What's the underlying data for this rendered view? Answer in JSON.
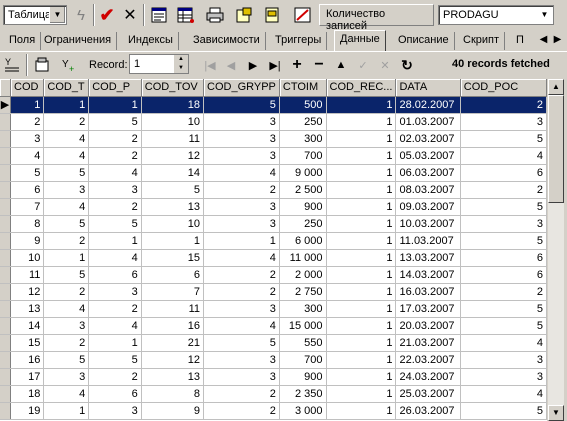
{
  "toolbar": {
    "table_select": "Таблица",
    "records_count_label": "Количество записей",
    "table_name_value": "PRODAGU"
  },
  "tabs": [
    {
      "label": "Поля"
    },
    {
      "label": "Ограничения"
    },
    {
      "label": "Индексы"
    },
    {
      "label": "Зависимости"
    },
    {
      "label": "Триггеры"
    },
    {
      "label": "Данные"
    },
    {
      "label": "Описание"
    },
    {
      "label": "Скрипт"
    },
    {
      "label": "П"
    }
  ],
  "navigator": {
    "record_label": "Record:",
    "record_value": "1",
    "fetched_text": "40 records fetched"
  },
  "grid": {
    "columns": [
      "COD",
      "COD_T",
      "COD_P",
      "COD_TOV",
      "COD_GRYPP",
      "CTOIM",
      "COD_REC...",
      "DATA",
      "COD_POC"
    ],
    "rows": [
      [
        "1",
        "1",
        "1",
        "18",
        "5",
        "500",
        "1",
        "28.02.2007",
        "2"
      ],
      [
        "2",
        "2",
        "5",
        "10",
        "3",
        "250",
        "1",
        "01.03.2007",
        "3"
      ],
      [
        "3",
        "4",
        "2",
        "11",
        "3",
        "300",
        "1",
        "02.03.2007",
        "5"
      ],
      [
        "4",
        "4",
        "2",
        "12",
        "3",
        "700",
        "1",
        "05.03.2007",
        "4"
      ],
      [
        "5",
        "5",
        "4",
        "14",
        "4",
        "9 000",
        "1",
        "06.03.2007",
        "6"
      ],
      [
        "6",
        "3",
        "3",
        "5",
        "2",
        "2 500",
        "1",
        "08.03.2007",
        "2"
      ],
      [
        "7",
        "4",
        "2",
        "13",
        "3",
        "900",
        "1",
        "09.03.2007",
        "5"
      ],
      [
        "8",
        "5",
        "5",
        "10",
        "3",
        "250",
        "1",
        "10.03.2007",
        "3"
      ],
      [
        "9",
        "2",
        "1",
        "1",
        "1",
        "6 000",
        "1",
        "11.03.2007",
        "5"
      ],
      [
        "10",
        "1",
        "4",
        "15",
        "4",
        "11 000",
        "1",
        "13.03.2007",
        "6"
      ],
      [
        "11",
        "5",
        "6",
        "6",
        "2",
        "2 000",
        "1",
        "14.03.2007",
        "6"
      ],
      [
        "12",
        "2",
        "3",
        "7",
        "2",
        "2 750",
        "1",
        "16.03.2007",
        "2"
      ],
      [
        "13",
        "4",
        "2",
        "11",
        "3",
        "300",
        "1",
        "17.03.2007",
        "5"
      ],
      [
        "14",
        "3",
        "4",
        "16",
        "4",
        "15 000",
        "1",
        "20.03.2007",
        "5"
      ],
      [
        "15",
        "2",
        "1",
        "21",
        "5",
        "550",
        "1",
        "21.03.2007",
        "4"
      ],
      [
        "16",
        "5",
        "5",
        "12",
        "3",
        "700",
        "1",
        "22.03.2007",
        "3"
      ],
      [
        "17",
        "3",
        "2",
        "13",
        "3",
        "900",
        "1",
        "24.03.2007",
        "3"
      ],
      [
        "18",
        "4",
        "6",
        "8",
        "2",
        "2 350",
        "1",
        "25.03.2007",
        "4"
      ],
      [
        "19",
        "1",
        "3",
        "9",
        "2",
        "3 000",
        "1",
        "26.03.2007",
        "5"
      ]
    ]
  }
}
